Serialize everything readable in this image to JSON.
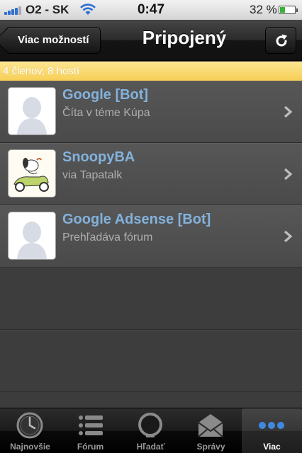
{
  "status_bar": {
    "carrier": "O2 - SK",
    "time": "0:47",
    "battery_percent_text": "32 %",
    "battery_level": 0.32
  },
  "nav": {
    "back_label": "Viac možností",
    "title": "Pripojený",
    "refresh_icon": "refresh-icon"
  },
  "banner": {
    "text": "4 členov, 8 hostí"
  },
  "users": [
    {
      "name": "Google [Bot]",
      "status": "Číta v téme Kúpa",
      "avatar": "default-avatar"
    },
    {
      "name": "SnoopyBA",
      "status": "via Tapatalk",
      "avatar": "snoopy-scooter-avatar"
    },
    {
      "name": "Google Adsense [Bot]",
      "status": "Prehľadáva fórum",
      "avatar": "default-avatar"
    }
  ],
  "tabs": [
    {
      "label": "Najnovšie",
      "icon": "clock-icon",
      "active": false
    },
    {
      "label": "Fórum",
      "icon": "list-icon",
      "active": false
    },
    {
      "label": "Hľadať",
      "icon": "search-icon",
      "active": false
    },
    {
      "label": "Správy",
      "icon": "envelope-icon",
      "active": false
    },
    {
      "label": "Viac",
      "icon": "more-dots-icon",
      "active": true
    }
  ],
  "colors": {
    "link_blue": "#83b2dd",
    "banner_yellow": "#f6cf55",
    "active_tab_dots": "#3f8ae0"
  }
}
